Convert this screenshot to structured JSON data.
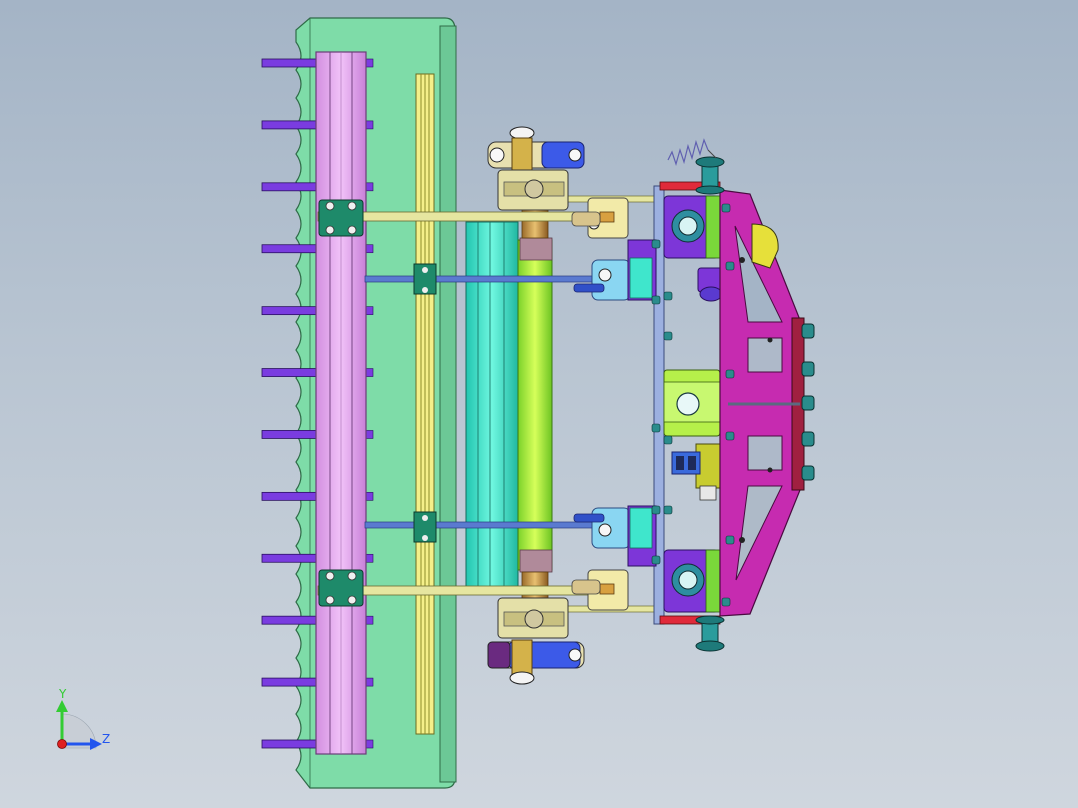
{
  "viewport": {
    "background_top": "#a4b4c6",
    "background_bottom": "#cfd6de"
  },
  "model": {
    "colors": {
      "hopper": "#7edca8",
      "hopper_edge": "#2f6b47",
      "rail": "#e6a6f0",
      "rail_edge": "#6a3c78",
      "tooth": "#7a3ce0",
      "roller_green": "#b8f53a",
      "cyan_block": "#3fe6cc",
      "tan_bracket": "#e6e6a0",
      "rod": "#a6b6d4",
      "bearing_block": "#7d36d8",
      "magenta_frame": "#c62bb0",
      "red_plate": "#e02a3a",
      "teal_knob": "#2a8c8c",
      "blue_link": "#2e54e0",
      "lime_block": "#b6f04a",
      "olive_box": "#d0d23a",
      "spring": "#8a8acf"
    },
    "tooth_count": 12
  },
  "triad": {
    "y_label": "Y",
    "z_label": "Z",
    "y_color": "#33cc33",
    "z_color": "#2255ee",
    "origin_color": "#e02020"
  }
}
